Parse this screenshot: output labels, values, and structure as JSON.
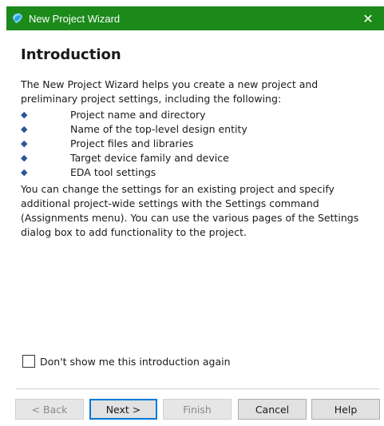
{
  "window": {
    "title": "New Project Wizard",
    "close_glyph": "✕",
    "icon": "quartus-app-icon",
    "titlebar_color": "#1b8a1b"
  },
  "page": {
    "heading": "Introduction",
    "intro_text": "The New Project Wizard helps you create a new project and preliminary project settings, including the following:",
    "bullets": [
      "Project name and directory",
      "Name of the top-level design entity",
      "Project files and libraries",
      "Target device family and device",
      "EDA tool settings"
    ],
    "bullet_glyph": "◆",
    "body_text": "You can change the settings for an existing project and specify additional project-wide settings with the Settings command (Assignments menu). You can use the various pages of the Settings dialog box to add functionality to the project."
  },
  "checkbox": {
    "label": "Don't show me this introduction again",
    "checked": false
  },
  "buttons": {
    "back": "< Back",
    "next": "Next >",
    "finish": "Finish",
    "cancel": "Cancel",
    "help": "Help"
  }
}
